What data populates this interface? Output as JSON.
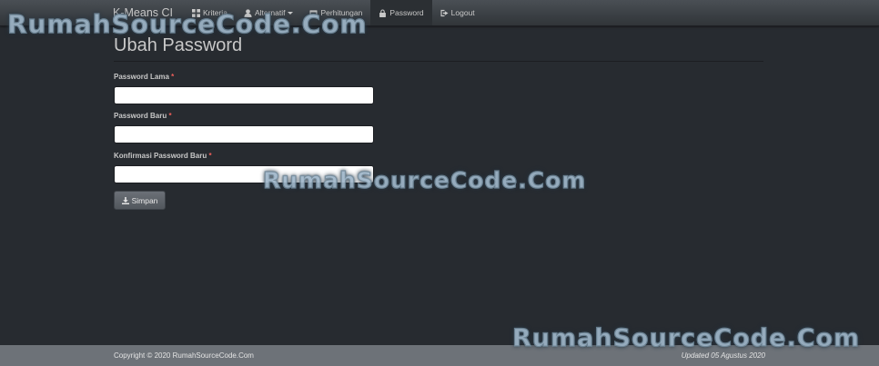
{
  "navbar": {
    "brand": "K-Means CI",
    "items": [
      {
        "label": "Kriteria",
        "icon": "grid-icon"
      },
      {
        "label": "Alternatif",
        "icon": "user-icon"
      },
      {
        "label": "Perhitungan",
        "icon": "calendar-icon"
      },
      {
        "label": "Password",
        "icon": "lock-icon"
      },
      {
        "label": "Logout",
        "icon": "logout-icon"
      }
    ],
    "active_item": "Password"
  },
  "page": {
    "title": "Ubah Password"
  },
  "form": {
    "required_mark": "*",
    "fields": [
      {
        "label": "Password Lama",
        "value": "",
        "placeholder": ""
      },
      {
        "label": "Password Baru",
        "value": "",
        "placeholder": ""
      },
      {
        "label": "Konfirmasi Password Baru",
        "value": "",
        "placeholder": ""
      }
    ],
    "submit_label": "Simpan",
    "submit_icon": "download-icon"
  },
  "footer": {
    "copyright": "Copyright © 2020 RumahSourceCode.Com",
    "updated": "Updated 05 Agustus 2020"
  },
  "watermark": {
    "text": "RumahSourceCode.Com"
  },
  "colors": {
    "background": "#272b30",
    "navbar": "#3a3f44",
    "footer": "#6d7278",
    "required": "#ee5f5b"
  }
}
